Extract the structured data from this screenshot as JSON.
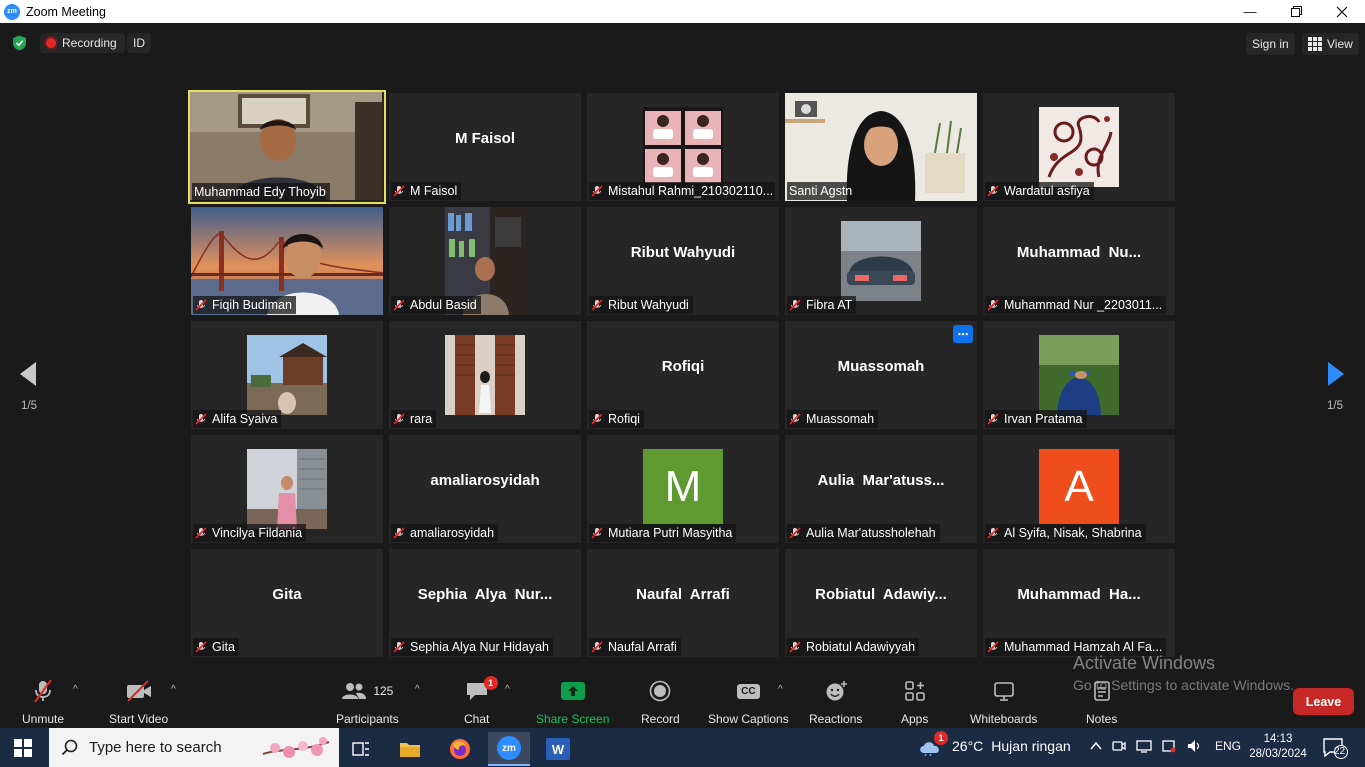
{
  "window": {
    "title": "Zoom Meeting"
  },
  "topbar": {
    "recording_label": "Recording",
    "id_label": "ID",
    "signin_label": "Sign in",
    "view_label": "View"
  },
  "pagination": {
    "left_page": "1/5",
    "right_page": "1/5"
  },
  "participants": [
    {
      "name": "Muhammad Edy Thoyib",
      "display": "",
      "video": "person-office",
      "muted": false,
      "active": true
    },
    {
      "name": "M Faisol",
      "display": "M Faisol",
      "video": "none",
      "muted": true
    },
    {
      "name": "Mistahul Rahmi_210302110...",
      "display": "",
      "video": "collage",
      "muted": true
    },
    {
      "name": "Santi Agstn",
      "display": "",
      "video": "person-hijab",
      "muted": false
    },
    {
      "name": "Wardatul asfiya",
      "display": "",
      "video": "batik",
      "muted": true
    },
    {
      "name": "Fiqih Budiman",
      "display": "",
      "video": "bridge",
      "muted": true
    },
    {
      "name": "Abdul Basid",
      "display": "",
      "video": "bookshelf",
      "muted": true
    },
    {
      "name": "Ribut Wahyudi",
      "display": "Ribut Wahyudi",
      "video": "none",
      "muted": true
    },
    {
      "name": "Fibra AT",
      "display": "",
      "video": "car",
      "muted": true
    },
    {
      "name": "Muhammad Nur _2203011...",
      "display": "Muhammad  Nu...",
      "video": "none",
      "muted": true
    },
    {
      "name": "Alifa Syaiva",
      "display": "",
      "video": "temple",
      "muted": true
    },
    {
      "name": "rara",
      "display": "",
      "video": "door",
      "muted": true
    },
    {
      "name": "Rofiqi",
      "display": "Rofiqi",
      "video": "none",
      "muted": true
    },
    {
      "name": "Muassomah",
      "display": "Muassomah",
      "video": "none",
      "muted": true,
      "more": true
    },
    {
      "name": "Irvan Pratama",
      "display": "",
      "video": "park",
      "muted": true
    },
    {
      "name": "Vincilya Fildania",
      "display": "",
      "video": "street",
      "muted": true
    },
    {
      "name": "amaliarosyidah",
      "display": "amaliarosyidah",
      "video": "none",
      "muted": true
    },
    {
      "name": "Mutiara Putri Masyitha",
      "display": "",
      "video": "letter",
      "letter": "M",
      "letter_color": "#5e9a2f",
      "muted": true
    },
    {
      "name": "Aulia Mar'atussholehah",
      "display": "Aulia  Mar'atuss...",
      "video": "none",
      "muted": true
    },
    {
      "name": "Al Syifa, Nisak, Shabrina",
      "display": "",
      "video": "letter",
      "letter": "A",
      "letter_color": "#f04d1c",
      "muted": true
    },
    {
      "name": "Gita",
      "display": "Gita",
      "video": "none",
      "muted": true
    },
    {
      "name": "Sephia Alya Nur Hidayah",
      "display": "Sephia  Alya  Nur...",
      "video": "none",
      "muted": true
    },
    {
      "name": "Naufal Arrafi",
      "display": "Naufal  Arrafi",
      "video": "none",
      "muted": true
    },
    {
      "name": "Robiatul Adawiyyah",
      "display": "Robiatul  Adawiy...",
      "video": "none",
      "muted": true
    },
    {
      "name": "Muhammad Hamzah Al Fa...",
      "display": "Muhammad  Ha...",
      "video": "none",
      "muted": true
    }
  ],
  "toolbar": {
    "unmute": "Unmute",
    "start_video": "Start Video",
    "participants": "Participants",
    "participants_count": "125",
    "chat": "Chat",
    "chat_badge": "1",
    "share_screen": "Share Screen",
    "record": "Record",
    "show_captions": "Show Captions",
    "reactions": "Reactions",
    "apps": "Apps",
    "whiteboards": "Whiteboards",
    "notes": "Notes",
    "leave": "Leave",
    "captions_icon_text": "CC"
  },
  "watermark": {
    "line1": "Activate Windows",
    "line2": "Go to Settings to activate Windows."
  },
  "taskbar": {
    "search_placeholder": "Type here to search",
    "weather_temp": "26°C",
    "weather_desc": "Hujan ringan",
    "weather_badge": "1",
    "lang": "ENG",
    "time": "14:13",
    "date": "28/03/2024",
    "notif_count": "22",
    "zoom_label": "zm",
    "word_label": "W"
  },
  "colors": {
    "accent_green": "#0e9f4d",
    "active_border": "#e4e05a",
    "leave_red": "#c62828",
    "brand_blue": "#2d8cff"
  }
}
